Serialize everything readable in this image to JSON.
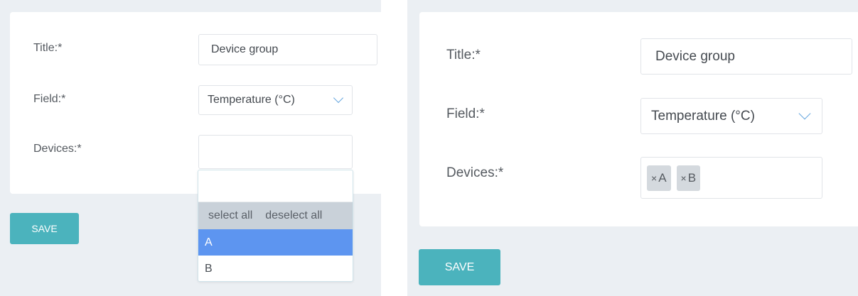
{
  "left_form": {
    "title_label": "Title:*",
    "title_value": "Device group",
    "field_label": "Field:*",
    "field_value": "Temperature (°C)",
    "devices_label": "Devices:*",
    "dropdown": {
      "search_value": "",
      "select_all": "select all",
      "deselect_all": "deselect all",
      "options": [
        "A",
        "B"
      ],
      "highlighted": "A"
    },
    "save_label": "SAVE"
  },
  "right_form": {
    "title_label": "Title:*",
    "title_value": "Device group",
    "field_label": "Field:*",
    "field_value": "Temperature (°C)",
    "devices_label": "Devices:*",
    "selected_devices": [
      {
        "remove": "×",
        "name": "A"
      },
      {
        "remove": "×",
        "name": "B"
      }
    ],
    "save_label": "SAVE"
  },
  "icons": {
    "select_arrow": "chevron-down-icon",
    "tag_remove": "close-icon"
  },
  "colors": {
    "accent_button": "#4bb3bd",
    "highlight_option": "#5d95f0",
    "chevron": "#67a7df",
    "background": "#ebeff3"
  }
}
